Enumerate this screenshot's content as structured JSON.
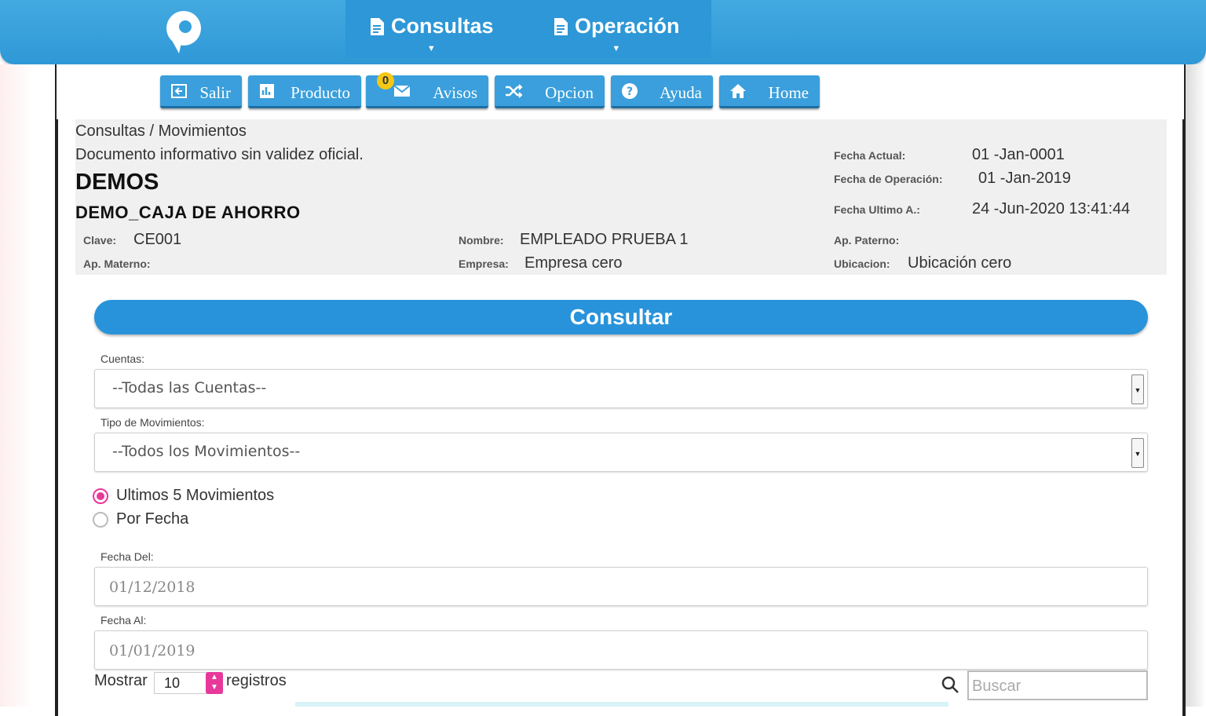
{
  "topnav": {
    "items": [
      {
        "label": "Consultas"
      },
      {
        "label": "Operación"
      }
    ]
  },
  "toolbar": {
    "buttons": [
      {
        "label": "Salir"
      },
      {
        "label": "Producto"
      },
      {
        "label": "Avisos"
      },
      {
        "label": "Opcion"
      },
      {
        "label": "Ayuda"
      },
      {
        "label": "Home"
      }
    ],
    "avisos_badge": "0"
  },
  "info": {
    "breadcrumb": "Consultas / Movimientos",
    "notice": "Documento informativo sin validez oficial.",
    "company": "DEMOS",
    "product": "DEMO_CAJA DE AHORRO",
    "fecha_actual_label": "Fecha Actual:",
    "fecha_actual": "01 -Jan-0001",
    "fecha_operacion_label": "Fecha de Operación:",
    "fecha_operacion": "01 -Jan-2019",
    "fecha_ultimo_label": "Fecha Ultimo A.:",
    "fecha_ultimo": "24 -Jun-2020 13:41:44",
    "clave_label": "Clave:",
    "clave": "CE001",
    "nombre_label": "Nombre:",
    "nombre": "EMPLEADO PRUEBA 1",
    "ap_paterno_label": "Ap. Paterno:",
    "ap_paterno": "",
    "ap_materno_label": "Ap. Materno:",
    "ap_materno": "",
    "empresa_label": "Empresa:",
    "empresa": "Empresa cero",
    "ubicacion_label": "Ubicacion:",
    "ubicacion": "Ubicación cero"
  },
  "consult": {
    "title": "Consultar",
    "cuentas_label": "Cuentas:",
    "cuentas_value": "--Todas las Cuentas--",
    "tipo_label": "Tipo de Movimientos:",
    "tipo_value": "--Todos los Movimientos--",
    "radio_ultimos": "Ultimos 5 Movimientos",
    "radio_fecha": "Por Fecha",
    "fecha_del_label": "Fecha Del:",
    "fecha_del": "01/12/2018",
    "fecha_al_label": "Fecha Al:",
    "fecha_al": "01/01/2019"
  },
  "table_controls": {
    "mostrar": "Mostrar",
    "page_size": "10",
    "registros": "registros",
    "search_placeholder": "Buscar"
  },
  "colors": {
    "brand_blue": "#2f98d6",
    "accent_pink": "#e8389c",
    "badge_yellow": "#f4c814"
  }
}
